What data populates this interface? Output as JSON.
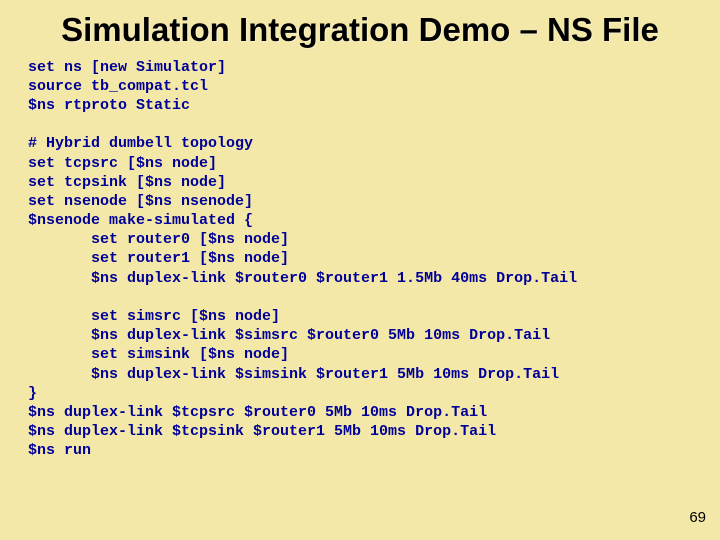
{
  "title": "Simulation Integration Demo – NS File",
  "code": "set ns [new Simulator]\nsource tb_compat.tcl\n$ns rtproto Static\n\n# Hybrid dumbell topology\nset tcpsrc [$ns node]\nset tcpsink [$ns node]\nset nsenode [$ns nsenode]\n$nsenode make-simulated {\n       set router0 [$ns node]\n       set router1 [$ns node]\n       $ns duplex-link $router0 $router1 1.5Mb 40ms Drop.Tail\n\n       set simsrc [$ns node]\n       $ns duplex-link $simsrc $router0 5Mb 10ms Drop.Tail\n       set simsink [$ns node]\n       $ns duplex-link $simsink $router1 5Mb 10ms Drop.Tail\n}\n$ns duplex-link $tcpsrc $router0 5Mb 10ms Drop.Tail\n$ns duplex-link $tcpsink $router1 5Mb 10ms Drop.Tail\n$ns run",
  "page_number": "69"
}
